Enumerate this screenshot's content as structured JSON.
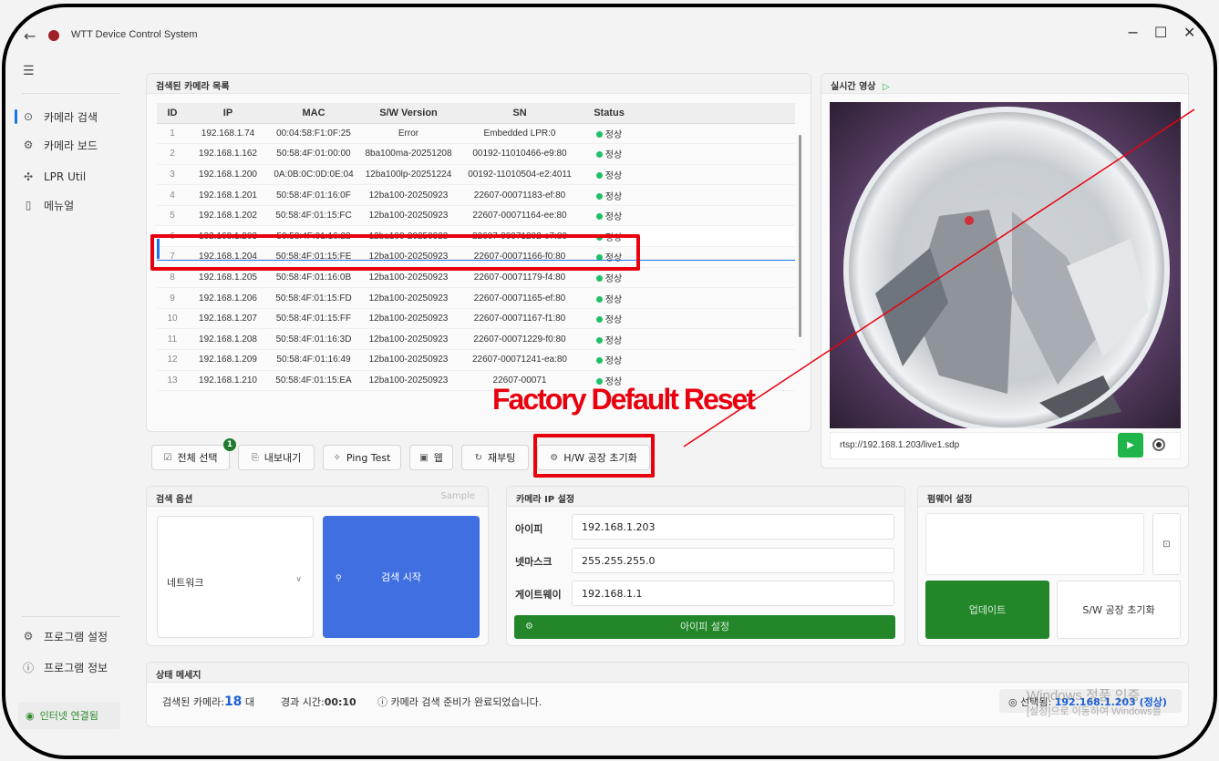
{
  "window": {
    "title": "WTT Device Control System",
    "back_icon": "←",
    "minimize": "−",
    "maximize": "☐",
    "close": "✕"
  },
  "sidebar": {
    "items": [
      {
        "label": "카메라 검색",
        "icon": "camera-icon"
      },
      {
        "label": "카메라 보드",
        "icon": "gear-icon"
      },
      {
        "label": "LPR Util",
        "icon": "fan-icon"
      },
      {
        "label": "메뉴얼",
        "icon": "document-icon"
      }
    ],
    "bottom_items": [
      {
        "label": "프로그램 설정",
        "icon": "gear-icon"
      },
      {
        "label": "프로그램 정보",
        "icon": "info-icon"
      }
    ],
    "network_status": "인터넷 연결됨"
  },
  "camera_list": {
    "title": "검색된 카메라 목록",
    "columns": [
      "ID",
      "IP",
      "MAC",
      "S/W Version",
      "SN",
      "Status"
    ],
    "rows": [
      [
        "1",
        "192.168.1.74",
        "00:04:58:F1:0F:25",
        "Error",
        "Embedded LPR:0",
        "정상"
      ],
      [
        "2",
        "192.168.1.162",
        "50:58:4F:01:00:00",
        "8ba100ma-20251208",
        "00192-11010466-e9:80",
        "정상"
      ],
      [
        "3",
        "192.168.1.200",
        "0A:0B:0C:0D:0E:04",
        "12ba100lp-20251224",
        "00192-11010504-e2:4011",
        "정상"
      ],
      [
        "4",
        "192.168.1.201",
        "50:58:4F:01:16:0F",
        "12ba100-20250923",
        "22607-00071183-ef:80",
        "정상"
      ],
      [
        "5",
        "192.168.1.202",
        "50:58:4F:01:15:FC",
        "12ba100-20250923",
        "22607-00071164-ee:80",
        "정상"
      ],
      [
        "6",
        "192.168.1.203",
        "50:58:4F:01:16:22",
        "12ba100-20250923",
        "22607-00071202-e7:80",
        "정상"
      ],
      [
        "7",
        "192.168.1.204",
        "50:58:4F:01:15:FE",
        "12ba100-20250923",
        "22607-00071166-f0:80",
        "정상"
      ],
      [
        "8",
        "192.168.1.205",
        "50:58:4F:01:16:0B",
        "12ba100-20250923",
        "22607-00071179-f4:80",
        "정상"
      ],
      [
        "9",
        "192.168.1.206",
        "50:58:4F:01:15:FD",
        "12ba100-20250923",
        "22607-00071165-ef:80",
        "정상"
      ],
      [
        "10",
        "192.168.1.207",
        "50:58:4F:01:15:FF",
        "12ba100-20250923",
        "22607-00071167-f1:80",
        "정상"
      ],
      [
        "11",
        "192.168.1.208",
        "50:58:4F:01:16:3D",
        "12ba100-20250923",
        "22607-00071229-f0:80",
        "정상"
      ],
      [
        "12",
        "192.168.1.209",
        "50:58:4F:01:16:49",
        "12ba100-20250923",
        "22607-00071241-ea:80",
        "정상"
      ],
      [
        "13",
        "192.168.1.210",
        "50:58:4F:01:15:EA",
        "12ba100-20250923",
        "22607-00071",
        "정상"
      ]
    ],
    "selected_row": 6
  },
  "annotation": "Factory Default Reset",
  "actions": {
    "select_all": "전체 선택",
    "select_all_badge": "1",
    "export": "내보내기",
    "ping_test": "Ping Test",
    "web": "웹",
    "reboot": "재부팅",
    "hw_factory_reset": "H/W 공장 초기화"
  },
  "live_video": {
    "title": "실시간 영상",
    "play_icon": "▷",
    "rtsp_url": "rtsp://192.168.1.203/live1.sdp"
  },
  "search_options": {
    "title": "검색 옵션",
    "sample": "Sample",
    "network_select": "네트워크",
    "start_search": "검색 시작"
  },
  "ip_settings": {
    "title": "카메라 IP 설정",
    "ip_label": "아이피",
    "ip_value": "192.168.1.203",
    "netmask_label": "넷마스크",
    "netmask_value": "255.255.255.0",
    "gateway_label": "게이트웨이",
    "gateway_value": "192.168.1.1",
    "apply_button": "아이피 설정"
  },
  "firmware": {
    "title": "펌웨어 설정",
    "update_button": "업데이트",
    "sw_reset_button": "S/W 공장 초기화"
  },
  "status": {
    "title": "상태 메세지",
    "found_label": "검색된 카메라:",
    "found_count": "18",
    "found_unit": "대",
    "elapsed_label": "경과 시간:",
    "elapsed_value": "00:10",
    "message": "카메라 검색 준비가 완료되었습니다.",
    "selected_label": "선택됨:",
    "selected_value": "192.168.1.203 (정상)"
  },
  "watermark": {
    "line1": "Windows 정품 인증",
    "line2": "[설정]으로 이동하여 Windows를"
  },
  "colors": {
    "accent_blue": "#3f6fe0",
    "green": "#23872a",
    "highlight_red": "#e8000e",
    "status_ok": "#1ec06a"
  }
}
